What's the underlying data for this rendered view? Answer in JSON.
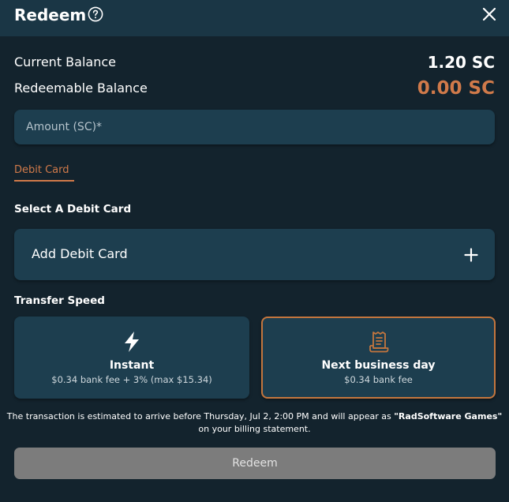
{
  "header": {
    "title": "Redeem",
    "help_icon": "question-circle-icon",
    "close_icon": "close-icon"
  },
  "balances": {
    "current_label": "Current Balance",
    "current_value": "1.20 SC",
    "redeemable_label": "Redeemable Balance",
    "redeemable_value": "0.00 SC",
    "redeemable_color": "#d07a4a"
  },
  "amount": {
    "placeholder": "Amount (SC)*",
    "value": ""
  },
  "tabs": [
    {
      "label": "Debit Card",
      "active": true,
      "color": "#d07a4a"
    }
  ],
  "debit_card": {
    "section_label": "Select A Debit Card",
    "add_label": "Add Debit Card",
    "add_icon": "plus-icon"
  },
  "transfer_speed": {
    "section_label": "Transfer Speed",
    "options": [
      {
        "title": "Instant",
        "subtitle": "$0.34 bank fee + 3% (max $15.34)",
        "icon": "lightning-bolt-icon",
        "selected": false
      },
      {
        "title": "Next business day",
        "subtitle": "$0.34 bank fee",
        "icon": "receipt-icon",
        "selected": true
      }
    ],
    "selected_border_color": "#c4763e"
  },
  "notice": {
    "line1_prefix": "The transaction is estimated to arrive before Thursday, Jul 2, 2:00 PM and will appear as ",
    "merchant": "\"RadSoftware Games\"",
    "line2": "on your billing statement."
  },
  "redeem_button": {
    "label": "Redeem",
    "enabled": false
  }
}
